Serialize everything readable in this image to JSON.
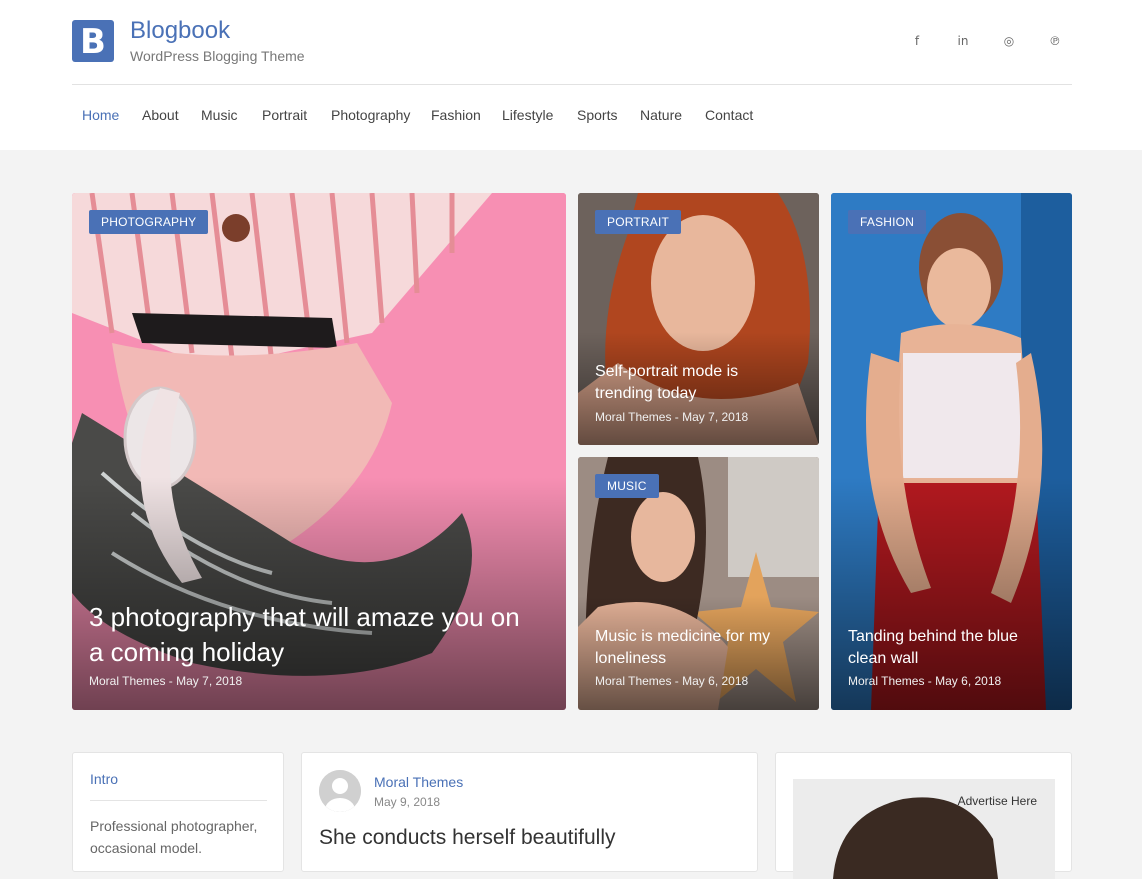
{
  "site": {
    "logo_letter": "B",
    "title": "Blogbook",
    "tagline": "WordPress Blogging Theme",
    "brand_color": "#4a71b6"
  },
  "socials": [
    {
      "icon": "facebook-icon",
      "glyph": "f"
    },
    {
      "icon": "linkedin-icon",
      "glyph": "in"
    },
    {
      "icon": "instagram-icon",
      "glyph": "◎"
    },
    {
      "icon": "pinterest-icon",
      "glyph": "℗"
    }
  ],
  "nav": {
    "items": [
      "Home",
      "About",
      "Music",
      "Portrait",
      "Photography",
      "Fashion",
      "Lifestyle",
      "Sports",
      "Nature",
      "Contact"
    ],
    "active": "Home"
  },
  "featured": [
    {
      "category": "PHOTOGRAPHY",
      "title_line1": "3 photography that will amaze you on",
      "title_line2": "a coming holiday",
      "meta": "Moral Themes - May 7, 2018"
    },
    {
      "category": "PORTRAIT",
      "title_line1": "Self-portrait mode is",
      "title_line2": "trending today",
      "meta": "Moral Themes - May 7, 2018"
    },
    {
      "category": "MUSIC",
      "title_line1": "Music is medicine for my",
      "title_line2": "loneliness",
      "meta": "Moral Themes - May 6, 2018"
    },
    {
      "category": "FASHION",
      "title_line1": "Tanding behind the blue",
      "title_line2": "clean wall",
      "meta": "Moral Themes - May 6, 2018"
    }
  ],
  "intro_widget": {
    "title": "Intro",
    "text_line1": "Professional photographer,",
    "text_line2": "occasional model."
  },
  "post": {
    "author": "Moral Themes",
    "date": "May 9, 2018",
    "title": "She conducts herself beautifully"
  },
  "ad_widget": {
    "label": "Advertise Here"
  }
}
